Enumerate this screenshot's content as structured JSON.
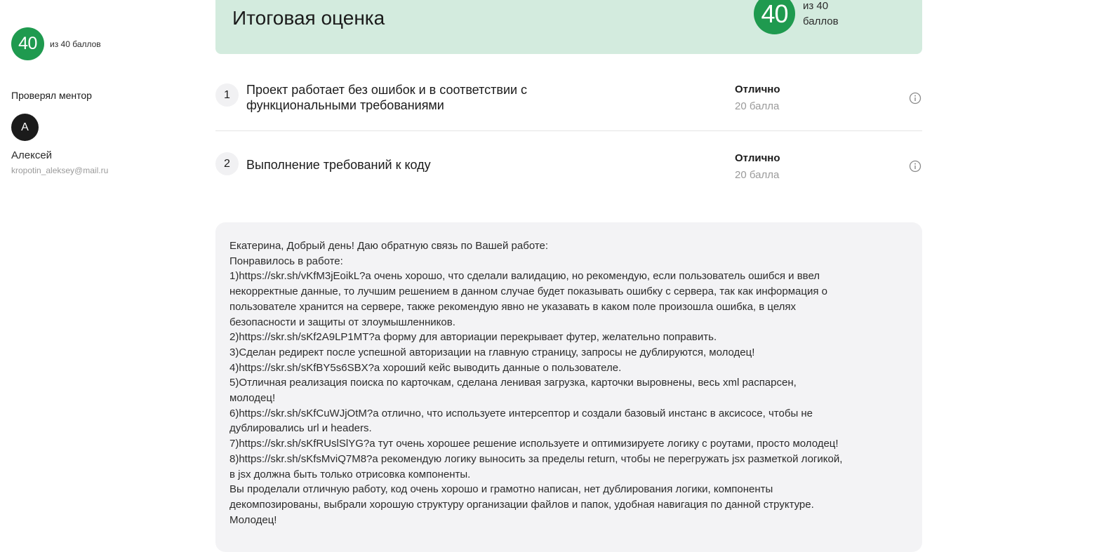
{
  "sidebar": {
    "score": "40",
    "score_of": "из 40 баллов",
    "mentor_label": "Проверял ментор",
    "avatar_letter": "А",
    "mentor_name": "Алексей",
    "mentor_email": "kropotin_aleksey@mail.ru"
  },
  "total": {
    "title": "Итоговая оценка",
    "score": "40",
    "score_of_line1": "из 40",
    "score_of_line2": "баллов"
  },
  "criteria": [
    {
      "number": "1",
      "title_line1": "Проект работает без ошибок и в соответствии с",
      "title_line2": "функциональными требованиями",
      "grade": "Отлично",
      "points": "20 балла"
    },
    {
      "number": "2",
      "title_line1": "Выполнение требований к коду",
      "title_line2": "",
      "grade": "Отлично",
      "points": "20 балла"
    }
  ],
  "feedback": {
    "lines": [
      "Екатерина, Добрый день! Даю обратную связь по Вашей работе:",
      "Понравилось в работе:",
      "1)https://skr.sh/vKfM3jEoikL?a очень хорошо, что сделали валидацию, но рекомендую, если пользователь ошибся и ввел",
      "некорректные данные, то лучшим решением в данном случае будет показывать ошибку с сервера, так как информация о",
      "пользователе хранится на сервере, также рекомендую явно не указавать в каком поле произошла ошибка, в целях",
      "безопасности и защиты от злоумышленников.",
      "2)https://skr.sh/sKf2A9LP1MT?a форму для авториации перекрывает футер, желательно поправить.",
      "3)Сделан редирект после успешной авторизации на главную страницу, запросы не дублируются, молодец!",
      "4)https://skr.sh/sKfBY5s6SBX?a хороший кейс выводить данные о пользователе.",
      "5)Отличная реализация поиска по карточкам, сделана ленивая загрузка, карточки выровнены, весь xml распарсен,",
      "молодец!",
      "6)https://skr.sh/sKfCuWJjOtM?a отлично, что используете интерсептор и создали базовый инстанс в аксисосе, чтобы не",
      "дублировались url и headers.",
      "7)https://skr.sh/sKfRUslSlYG?a тут очень хорошее решение используете и оптимизируете логику с роутами, просто молодец!",
      "8)https://skr.sh/sKfsMviQ7M8?a рекомендую логику выносить за пределы return, чтобы не перегружать jsx разметкой логикой,",
      "в jsx должна быть только отрисовка компоненты.",
      "Вы проделали отличную работу, код очень хорошо и грамотно написан, нет дублирования логики, компоненты",
      "декомпозированы, выбрали хорошую структуру организации файлов и папок, удобная навигация по данной структуре.",
      "Молодец!"
    ]
  },
  "icons": {
    "info": "info-circle-icon"
  },
  "colors": {
    "score_green": "#1f9a4f",
    "banner_bg": "#d3ebde",
    "feedback_bg": "#f3f3f5",
    "muted_text": "#9a9a9a"
  }
}
